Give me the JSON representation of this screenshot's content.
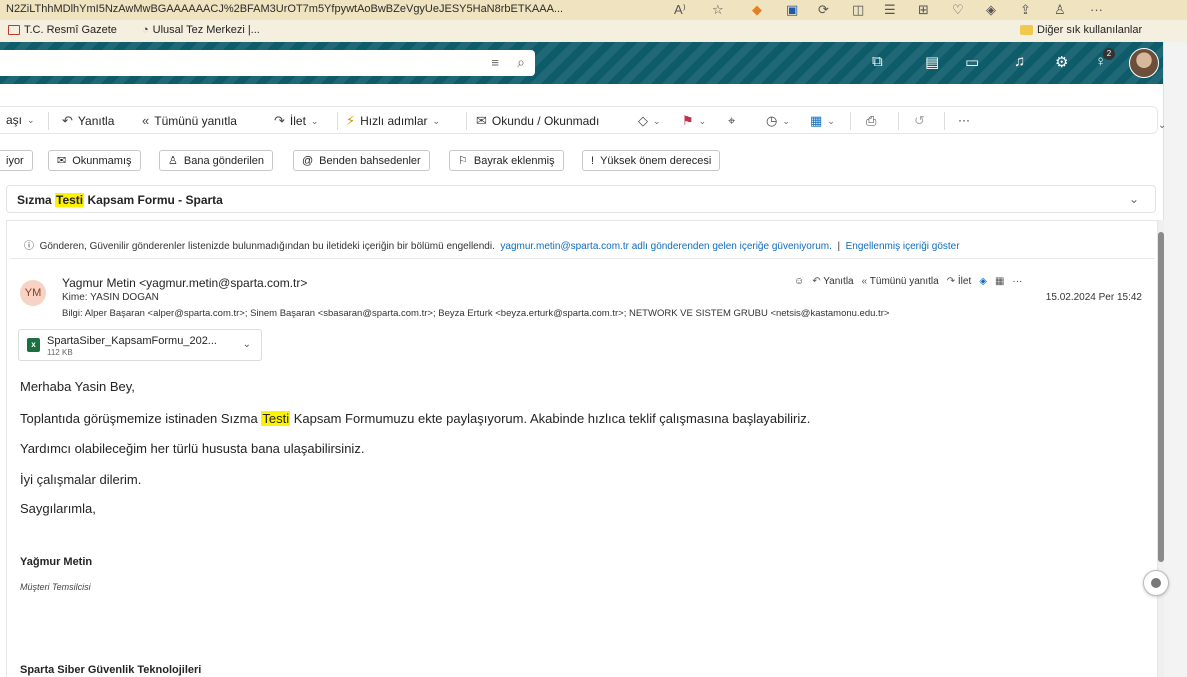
{
  "browser": {
    "url": "N2ZiLThhMDlhYmI5NzAwMwBGAAAAAACJ%2BFAM3UrOT7m5YfpywtAoBwBZeVgyUeJESY5HaN8rbETKAAA...",
    "bookmarks": [
      {
        "label": "T.C. Resmî Gazete"
      },
      {
        "label": "Ulusal Tez Merkezi |..."
      }
    ],
    "favorites_label": "Diğer sık kullanılanlar"
  },
  "header": {
    "notification_count": "2"
  },
  "ribbon": {
    "back_label": "aşı",
    "reply": "Yanıtla",
    "reply_all": "Tümünü yanıtla",
    "forward": "İlet",
    "quick_steps": "Hızlı adımlar",
    "read_unread": "Okundu / Okunmadı",
    "more": "···"
  },
  "filters": [
    {
      "label": "iyor"
    },
    {
      "label": "Okunmamış"
    },
    {
      "label": "Bana gönderilen"
    },
    {
      "label": "Benden bahsedenler"
    },
    {
      "label": "Bayrak eklenmiş"
    },
    {
      "label": "Yüksek önem derecesi"
    }
  ],
  "subject": {
    "before": "Sızma ",
    "highlight": "Testi",
    "after": " Kapsam Formu - Sparta"
  },
  "warning": {
    "text": "Gönderen, Güvenilir gönderenler listenizde bulunmadığından bu iletideki içeriğin bir bölümü engellendi.",
    "trust_link": "yagmur.metin@sparta.com.tr adlı gönderenden gelen içeriğe güveniyorum.",
    "separator": "|",
    "show_link": "Engellenmiş içeriği göster"
  },
  "message": {
    "initials": "YM",
    "sender": "Yagmur Metin <yagmur.metin@sparta.com.tr>",
    "to": "Kime:  YASIN DOGAN",
    "cc": "Bilgi:  Alper Başaran <alper@sparta.com.tr>;  Sinem Başaran <sbasaran@sparta.com.tr>;  Beyza Erturk <beyza.erturk@sparta.com.tr>;  NETWORK VE SISTEM GRUBU <netsis@kastamonu.edu.tr>",
    "date": "15.02.2024 Per 15:42",
    "reply": "Yanıtla",
    "reply_all": "Tümünü yanıtla",
    "forward": "İlet",
    "more": "···"
  },
  "attachment": {
    "name": "SpartaSiber_KapsamFormu_202...",
    "size": "112 KB",
    "type_letter": "x"
  },
  "body": {
    "greeting": "Merhaba Yasin Bey,",
    "p1_before": "Toplantıda görüşmemize istinaden Sızma ",
    "p1_highlight": "Testi",
    "p1_after": " Kapsam Formumuzu ekte paylaşıyorum. Akabinde hızlıca teklif çalışmasına başlayabiliriz.",
    "p2": "Yardımcı olabileceğim her türlü hususta bana ulaşabilirsiniz.",
    "p3": "İyi çalışmalar dilerim.",
    "closing": "Saygılarımla,",
    "sig_name": "Yağmur Metin",
    "sig_title": "Müşteri Temsilcisi",
    "company": "Sparta Siber Güvenlik Teknolojileri"
  }
}
